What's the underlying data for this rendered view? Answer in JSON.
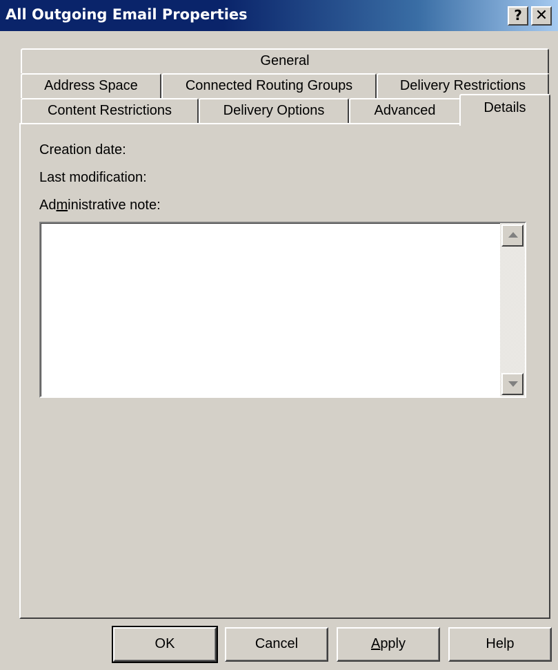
{
  "window": {
    "title": "All Outgoing Email Properties",
    "help_glyph": "?",
    "close_glyph": "✕"
  },
  "tabs": {
    "row1": [
      "General"
    ],
    "row2": [
      "Address Space",
      "Connected Routing Groups",
      "Delivery Restrictions"
    ],
    "row3": [
      "Content Restrictions",
      "Delivery Options",
      "Advanced",
      "Details"
    ],
    "active": "Details"
  },
  "details": {
    "creation_date_label": "Creation date:",
    "last_modification_label": "Last modification:",
    "admin_note_label_pre": "Ad",
    "admin_note_label_mnemonic": "m",
    "admin_note_label_post": "inistrative note:",
    "admin_note_value": ""
  },
  "buttons": {
    "ok": "OK",
    "cancel": "Cancel",
    "apply_mnemonic": "A",
    "apply_rest": "pply",
    "help": "Help"
  },
  "colors": {
    "face": "#d4d0c8",
    "title_active": "#0a246a",
    "title_gradient_end": "#a6caf0"
  }
}
